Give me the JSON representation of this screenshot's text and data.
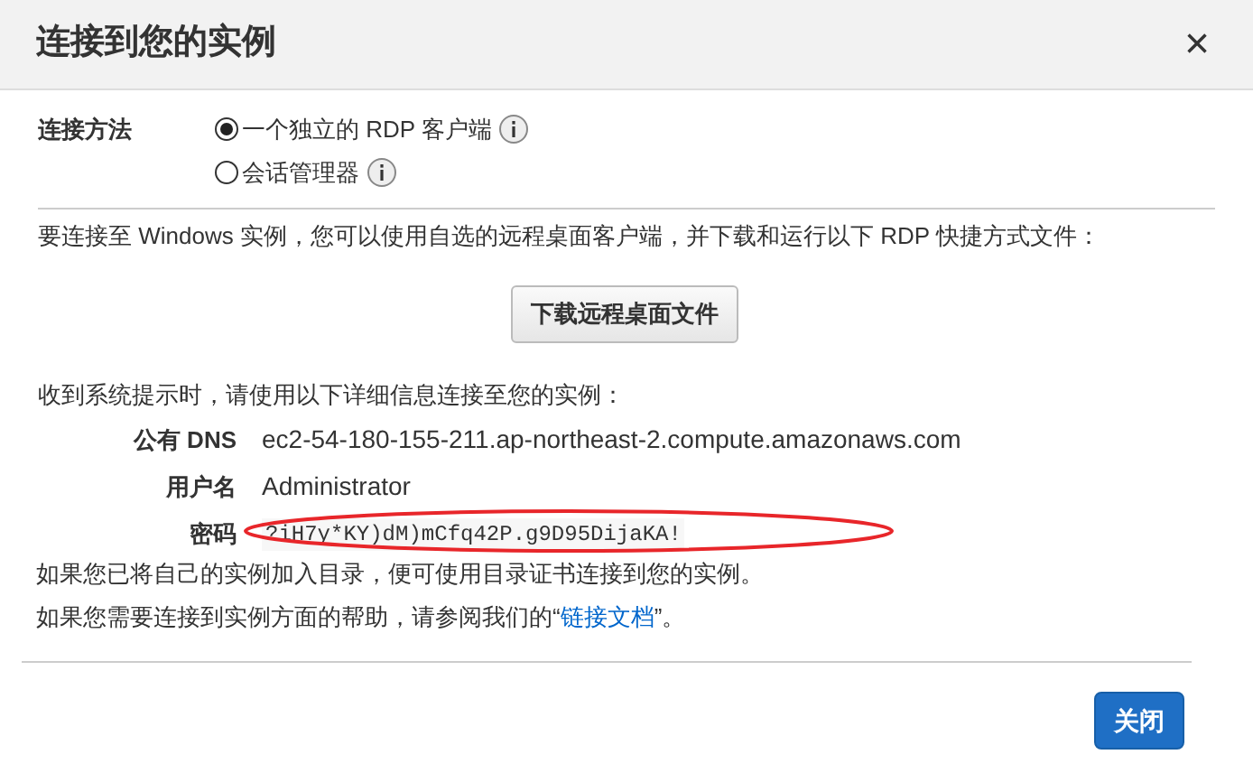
{
  "dialog": {
    "title": "连接到您的实例",
    "close_icon": "×"
  },
  "connection_method": {
    "label": "连接方法",
    "options": [
      {
        "label": "一个独立的 RDP 客户端",
        "selected": true
      },
      {
        "label": "会话管理器",
        "selected": false
      }
    ]
  },
  "intro": "要连接至 Windows 实例，您可以使用自选的远程桌面客户端，并下载和运行以下 RDP 快捷方式文件：",
  "download_button": "下载远程桌面文件",
  "prompt": "收到系统提示时，请使用以下详细信息连接至您的实例：",
  "details": [
    {
      "label": "公有 DNS",
      "value": "ec2-54-180-155-211.ap-northeast-2.compute.amazonaws.com",
      "kind": "text"
    },
    {
      "label": "用户名",
      "value": "Administrator",
      "kind": "text"
    },
    {
      "label": "密码",
      "value": "?iH7y*KY)dM)mCfq42P.g9D95DijaKA!",
      "kind": "code"
    }
  ],
  "note": "如果您已将自己的实例加入目录，便可使用目录证书连接到您的实例。",
  "help": {
    "before": "如果您需要连接到实例方面的帮助，请参阅我们的“",
    "link": "链接文档",
    "after": "”。"
  },
  "footer": {
    "close_button": "关闭"
  }
}
